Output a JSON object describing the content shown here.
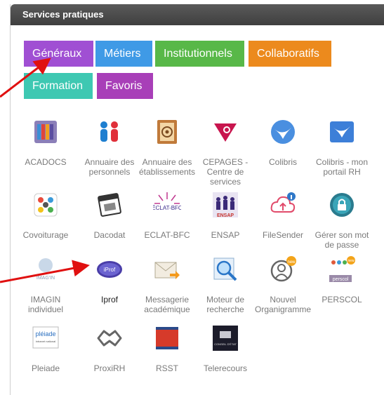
{
  "panel": {
    "title": "Services pratiques"
  },
  "tabs": [
    {
      "label": "Généraux",
      "color": "#a04fd3"
    },
    {
      "label": "Métiers",
      "color": "#3f9ae6"
    },
    {
      "label": "Institutionnels",
      "color": "#58b848"
    },
    {
      "label": "Collaboratifs",
      "color": "#ec8a1d"
    },
    {
      "label": "Formation",
      "color": "#3ec8b2"
    },
    {
      "label": "Favoris",
      "color": "#a83fb8"
    }
  ],
  "tiles": [
    {
      "label": "ACADOCS",
      "icon": "binders-icon"
    },
    {
      "label": "Annuaire des personnels",
      "icon": "people-icon"
    },
    {
      "label": "Annuaire des établissements",
      "icon": "address-book-icon"
    },
    {
      "label": "CEPAGES - Centre de services",
      "icon": "triangle-icon"
    },
    {
      "label": "Colibris",
      "icon": "bird-icon"
    },
    {
      "label": "Colibris - mon portail RH",
      "icon": "bird-portal-icon"
    },
    {
      "label": "Covoiturage",
      "icon": "carpool-icon"
    },
    {
      "label": "Dacodat",
      "icon": "calendar-icon"
    },
    {
      "label": "ECLAT-BFC",
      "icon": "eclat-logo-icon",
      "logo_text": "ÉCLAT-BFC"
    },
    {
      "label": "ENSAP",
      "icon": "ensap-icon",
      "logo_text": "ENSAP"
    },
    {
      "label": "FileSender",
      "icon": "cloud-upload-icon"
    },
    {
      "label": "Gérer son mot de passe",
      "icon": "lock-icon"
    },
    {
      "label": "IMAGIN individuel",
      "icon": "imagin-icon",
      "logo_text": "IMAG'IN"
    },
    {
      "label": "Iprof",
      "icon": "iprof-icon",
      "logo_text": "iProf"
    },
    {
      "label": "Messagerie académique",
      "icon": "envelope-icon"
    },
    {
      "label": "Moteur de recherche",
      "icon": "magnifier-icon"
    },
    {
      "label": "Nouvel Organigramme",
      "icon": "organigram-icon",
      "logo_text": "new"
    },
    {
      "label": "PERSCOL",
      "icon": "perscol-icon",
      "logo_text": "perscol",
      "badge_text": "new"
    },
    {
      "label": "Pleiade",
      "icon": "pleiade-icon",
      "logo_text": "pléiade",
      "logo_sub": "intranet national"
    },
    {
      "label": "ProxiRH",
      "icon": "handshake-icon"
    },
    {
      "label": "RSST",
      "icon": "register-icon"
    },
    {
      "label": "Telerecours",
      "icon": "telerecours-icon",
      "logo_text": "CONSEIL D'ÉTAT"
    }
  ]
}
